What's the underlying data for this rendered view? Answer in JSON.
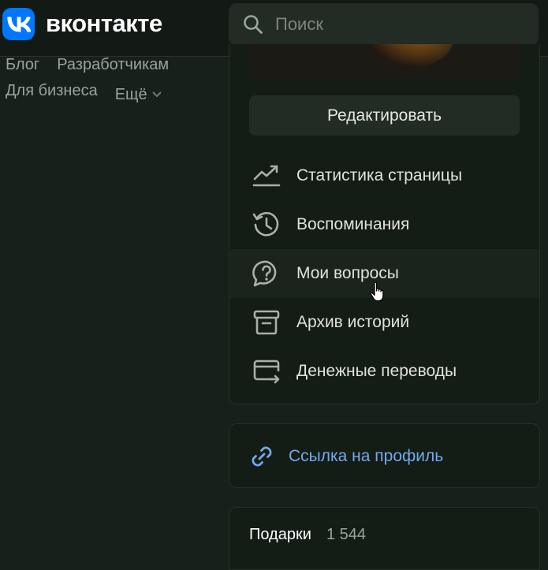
{
  "header": {
    "logo_text": "вконтакте",
    "search": {
      "placeholder": "Поиск",
      "value": ""
    }
  },
  "left_links": {
    "row1": [
      "Блог",
      "Разработчикам"
    ],
    "row2": [
      "Для бизнеса"
    ],
    "more_label": "Ещё"
  },
  "profile_menu": {
    "edit_label": "Редактировать",
    "items": [
      {
        "label": "Статистика страницы",
        "icon": "stats-chart-icon"
      },
      {
        "label": "Воспоминания",
        "icon": "history-icon"
      },
      {
        "label": "Мои вопросы",
        "icon": "question-bubble-icon",
        "hovered": true
      },
      {
        "label": "Архив историй",
        "icon": "archive-icon"
      },
      {
        "label": "Денежные переводы",
        "icon": "money-transfer-icon"
      }
    ]
  },
  "profile_link": {
    "label": "Ссылка на профиль",
    "icon": "link-icon"
  },
  "gifts": {
    "title": "Подарки",
    "count": "1 544"
  },
  "colors": {
    "background": "#17201a",
    "card": "#141c16",
    "accent_blue": "#71aaeb",
    "vk_blue": "#0077ff"
  }
}
